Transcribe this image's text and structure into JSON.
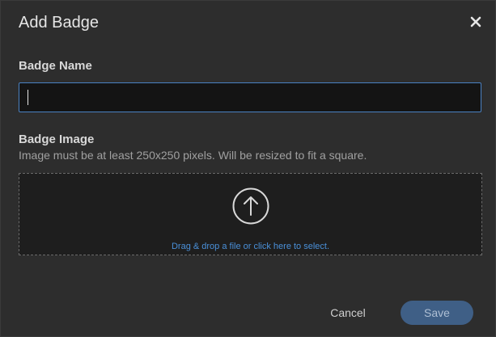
{
  "dialog": {
    "title": "Add Badge",
    "close_icon": "close-icon"
  },
  "badge_name": {
    "label": "Badge Name",
    "value": "",
    "placeholder": ""
  },
  "badge_image": {
    "label": "Badge Image",
    "hint": "Image must be at least 250x250 pixels. Will be resized to fit a square.",
    "upload_icon": "upload-arrow-icon",
    "drop_text": "Drag & drop a file or click here to select."
  },
  "actions": {
    "cancel_label": "Cancel",
    "save_label": "Save"
  },
  "colors": {
    "background": "#2d2d2d",
    "input_focus_border": "#4a82c4",
    "link": "#4a90d9",
    "save_button": "#3f5f86"
  }
}
